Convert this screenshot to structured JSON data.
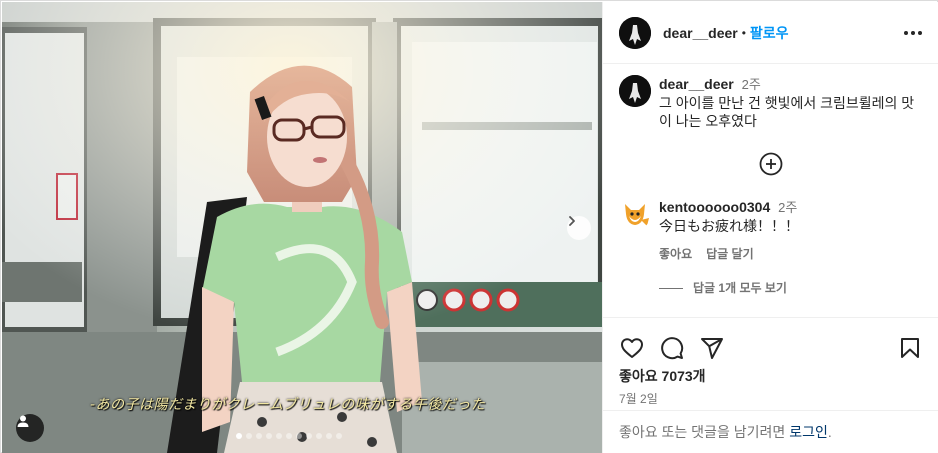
{
  "post": {
    "username": "dear__deer",
    "separator": "•",
    "follow_label": "팔로우",
    "more_icon": "more-horizontal-icon"
  },
  "photo": {
    "caption": "-あの子は陽だまりがクレームブリュレの味がする午後だった",
    "slide_count": 11,
    "active_slide": 1
  },
  "caption_comment": {
    "username": "dear__deer",
    "time": "2주",
    "text": "그 아이를 만난 건 햇빛에서 크림브륄레의 맛이 나는 오후였다"
  },
  "comments": [
    {
      "username": "kentoooooo0304",
      "time": "2주",
      "text": "今日もお疲れ様！！！",
      "like_label": "좋아요",
      "reply_label": "답글 달기",
      "view_replies_label": "답글 1개 모두 보기"
    }
  ],
  "actions": {
    "likes_text": "좋아요 7073개",
    "date": "7월 2일"
  },
  "login_prompt": {
    "text": "좋아요 또는 댓글을 남기려면",
    "link": "로그인",
    "suffix": "."
  },
  "colors": {
    "link_blue": "#0095f6",
    "login_link": "#00376b",
    "caption_text": "#f2e7a2"
  }
}
